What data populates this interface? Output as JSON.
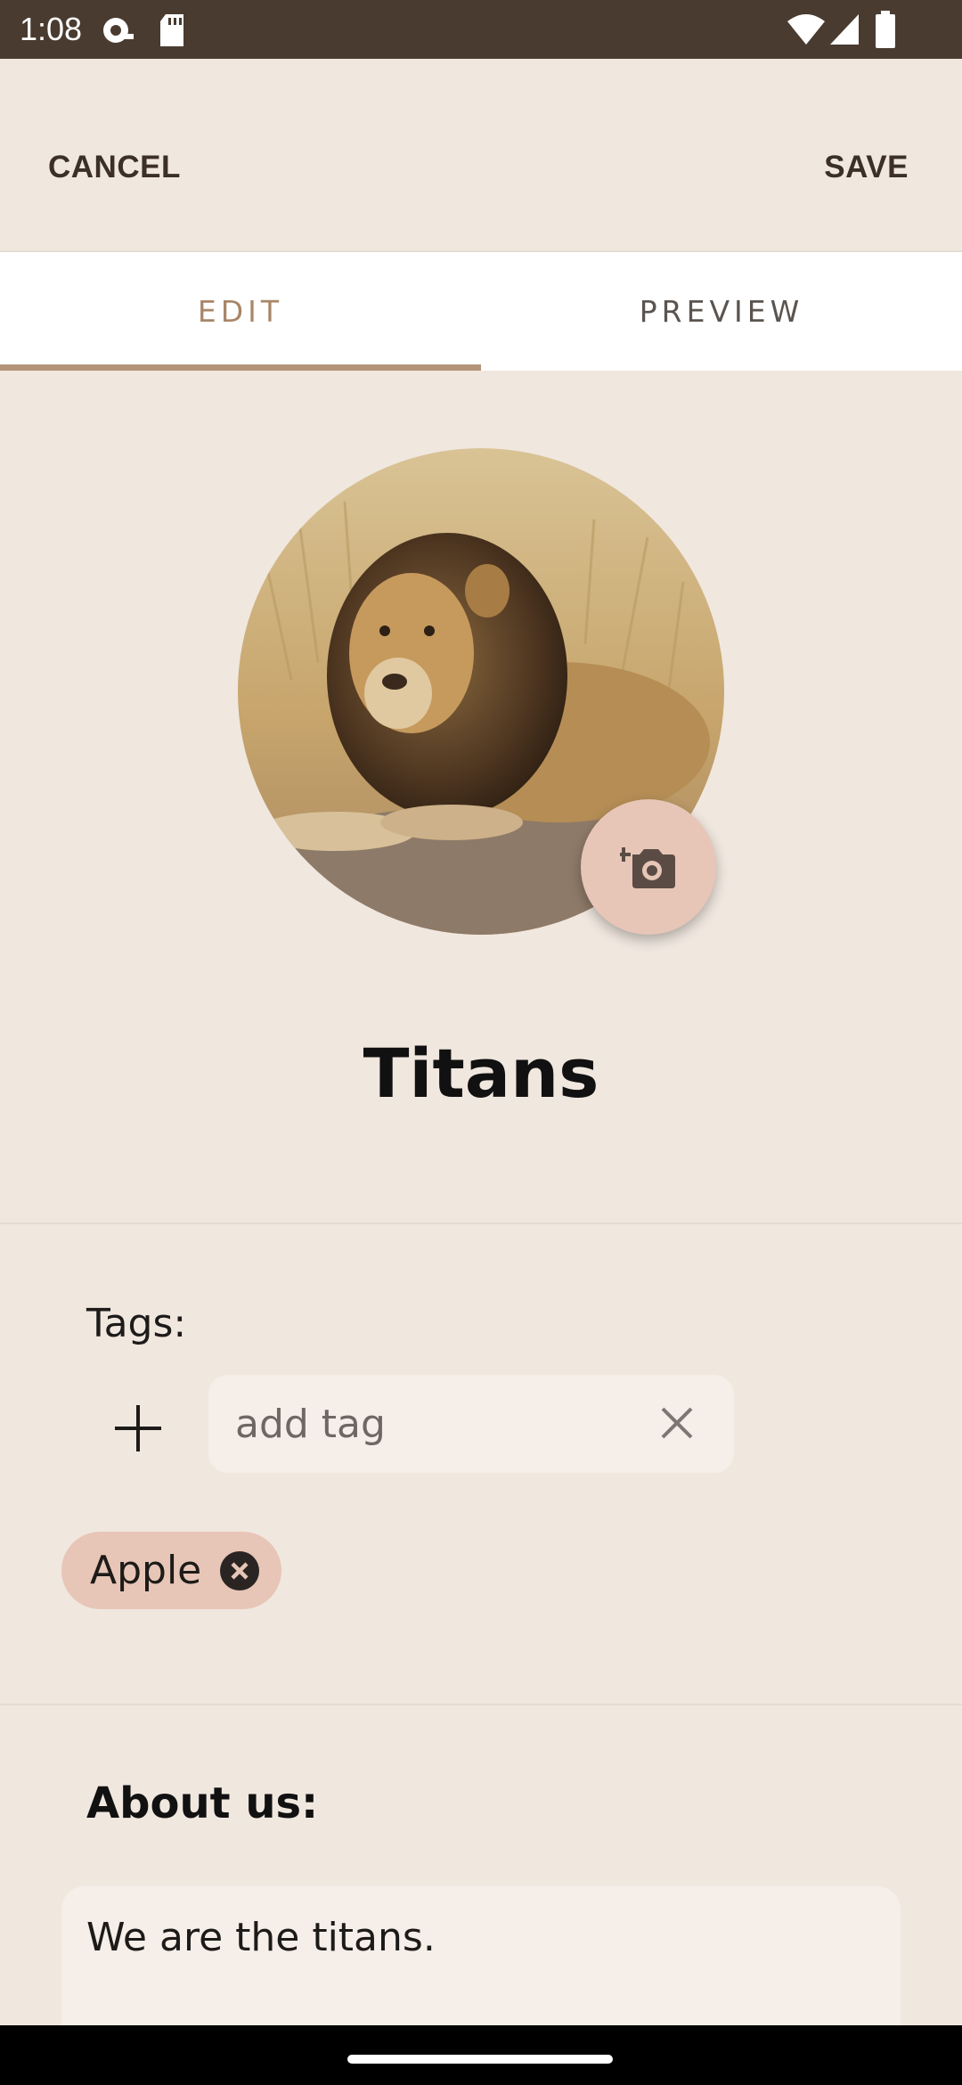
{
  "status_bar": {
    "time": "1:08",
    "icons": [
      "notification-icon",
      "sd-card-icon",
      "wifi-icon",
      "signal-icon",
      "battery-icon"
    ]
  },
  "app_bar": {
    "cancel_label": "CANCEL",
    "save_label": "SAVE"
  },
  "tabs": [
    {
      "label": "EDIT",
      "selected": true
    },
    {
      "label": "PREVIEW",
      "selected": false
    }
  ],
  "profile": {
    "name": "Titans",
    "camera_icon": "add-a-photo-icon"
  },
  "tags": {
    "label": "Tags:",
    "input_placeholder": "add tag",
    "input_value": "",
    "items": [
      {
        "label": "Apple"
      }
    ]
  },
  "about": {
    "label": "About us:",
    "text": "We are the titans."
  },
  "colors": {
    "status_bar": "#4a3b30",
    "background": "#f0e7df",
    "accent": "#b39478",
    "chip": "#e7c6b7",
    "input_bg": "#f6eee8"
  }
}
